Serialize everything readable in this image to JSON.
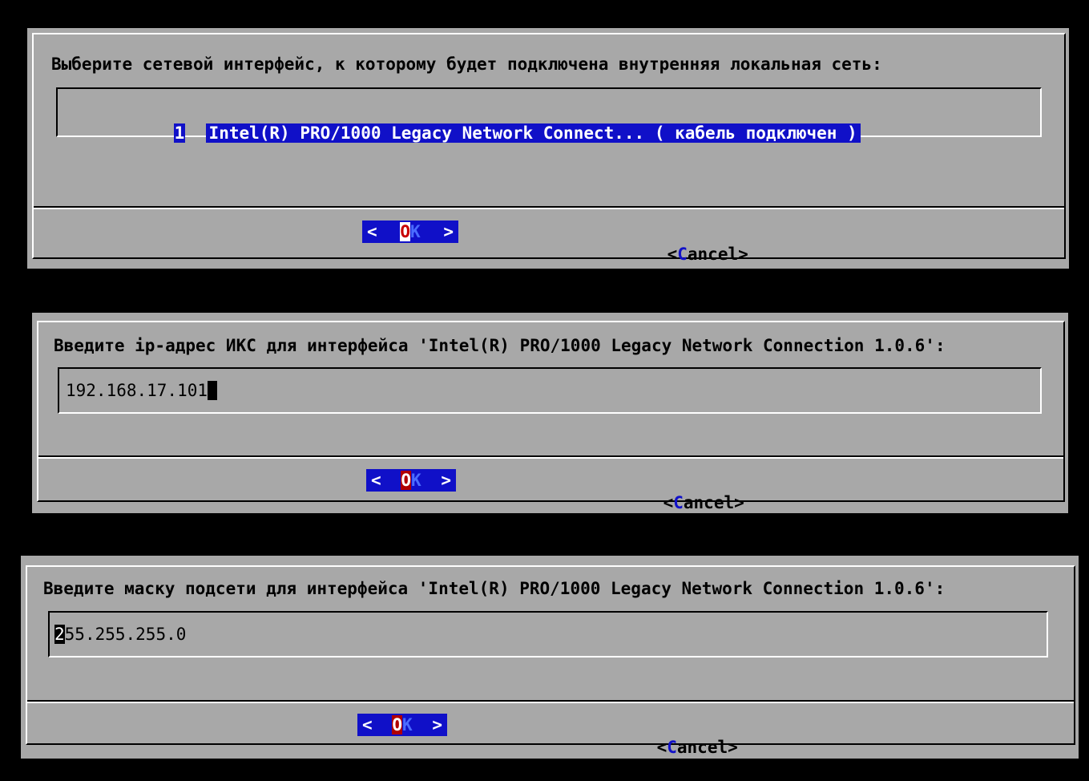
{
  "dialog1": {
    "prompt": "Выберите сетевой интерфейс, к которому будет подключена внутренняя локальная сеть:",
    "items": [
      {
        "number": "1",
        "label": "Intel(R) PRO/1000 Legacy Network Connect... ( кабель подключен )"
      }
    ],
    "ok": {
      "left": "<",
      "hot": "O",
      "rest": "K",
      "right": ">"
    },
    "cancel": {
      "left": "<",
      "hot": "C",
      "rest": "ancel",
      "right": ">"
    }
  },
  "dialog2": {
    "prompt": "Введите ip-адрес ИКС для интерфейса 'Intel(R) PRO/1000 Legacy Network Connection 1.0.6':",
    "value": "192.168.17.101",
    "ok": {
      "left": "<",
      "hot": "O",
      "rest": "K",
      "right": ">"
    },
    "cancel": {
      "left": "<",
      "hot": "C",
      "rest": "ancel",
      "right": ">"
    }
  },
  "dialog3": {
    "prompt": "Введите маску подсети для интерфейса 'Intel(R) PRO/1000 Legacy Network Connection 1.0.6':",
    "value_first": "2",
    "value_rest": "55.255.255.0",
    "ok": {
      "left": "<",
      "hot": "O",
      "rest": "K",
      "right": ">"
    },
    "cancel": {
      "left": "<",
      "hot": "C",
      "rest": "ancel",
      "right": ">"
    }
  },
  "colors": {
    "background": "#000000",
    "dialog": "#a8a8a8",
    "selection": "#1010c8",
    "hotkey": "#c80000"
  }
}
